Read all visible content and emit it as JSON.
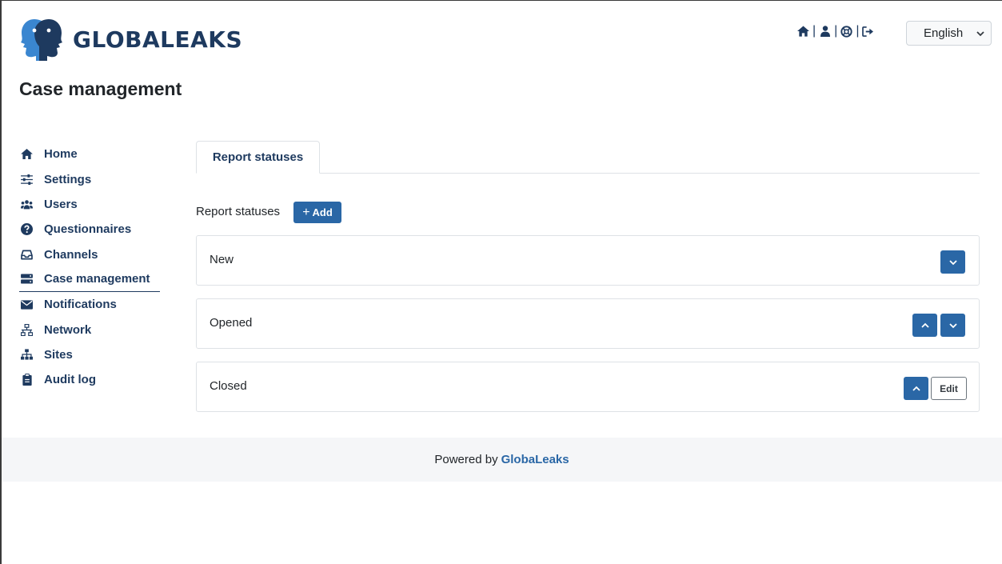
{
  "header": {
    "brand": "GLOBALEAKS",
    "nav_icons": [
      "home-icon",
      "user-icon",
      "help-icon",
      "logout-icon"
    ],
    "language": "English"
  },
  "page_title": "Case management",
  "sidebar": {
    "items": [
      {
        "label": "Home",
        "icon": "home-icon"
      },
      {
        "label": "Settings",
        "icon": "sliders-icon"
      },
      {
        "label": "Users",
        "icon": "users-icon"
      },
      {
        "label": "Questionnaires",
        "icon": "question-circle-icon"
      },
      {
        "label": "Channels",
        "icon": "inbox-icon"
      },
      {
        "label": "Case management",
        "icon": "server-icon",
        "active": true
      },
      {
        "label": "Notifications",
        "icon": "envelope-icon"
      },
      {
        "label": "Network",
        "icon": "network-icon"
      },
      {
        "label": "Sites",
        "icon": "sitemap-icon"
      },
      {
        "label": "Audit log",
        "icon": "clipboard-icon"
      }
    ]
  },
  "tabs": [
    {
      "label": "Report statuses",
      "active": true
    }
  ],
  "content": {
    "section_label": "Report statuses",
    "add_button": "Add",
    "statuses": [
      {
        "name": "New",
        "controls": [
          "move-down"
        ]
      },
      {
        "name": "Opened",
        "controls": [
          "move-up",
          "move-down"
        ]
      },
      {
        "name": "Closed",
        "controls": [
          "move-up",
          "edit"
        ]
      }
    ],
    "edit_label": "Edit"
  },
  "footer": {
    "text": "Powered by",
    "brand": "GlobaLeaks"
  },
  "colors": {
    "primary": "#2a67a6",
    "nav_text": "#1e3a5f",
    "logo_blue": "#3a86d0",
    "footer_bg": "#f5f6f8"
  }
}
